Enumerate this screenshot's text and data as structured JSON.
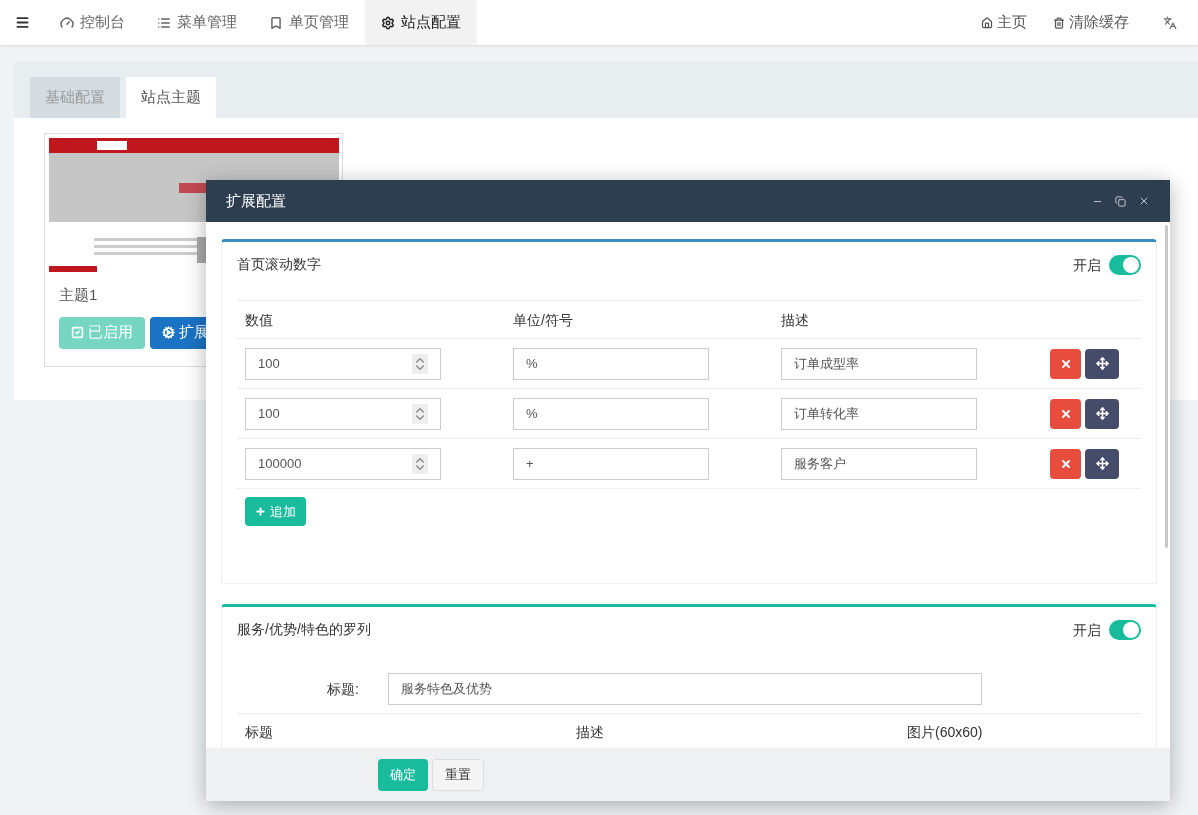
{
  "nav": {
    "items": [
      {
        "label": "控制台",
        "selected": false
      },
      {
        "label": "菜单管理",
        "selected": false
      },
      {
        "label": "单页管理",
        "selected": false
      },
      {
        "label": "站点配置",
        "selected": true
      }
    ],
    "right": [
      {
        "label": "主页"
      },
      {
        "label": "清除缓存"
      }
    ]
  },
  "tabs": [
    {
      "label": "基础配置",
      "selected": false
    },
    {
      "label": "站点主题",
      "selected": true
    }
  ],
  "theme": {
    "name": "主题1",
    "buttons": [
      {
        "label": "已启用",
        "kind": "enabled"
      },
      {
        "label": "扩展",
        "kind": "config"
      }
    ]
  },
  "modal": {
    "title": "扩展配置",
    "sections": [
      {
        "kind": "number_list",
        "title": "首页滚动数字",
        "color": "#3c8dbc",
        "toggle": {
          "label": "开启",
          "on": true
        },
        "columns": [
          "数值",
          "单位/符号",
          "描述"
        ],
        "rows": [
          {
            "value": "100",
            "unit": "%",
            "description": "订单成型率"
          },
          {
            "value": "100",
            "unit": "%",
            "description": "订单转化率"
          },
          {
            "value": "100000",
            "unit": "+",
            "description": "服务客户"
          }
        ],
        "add_button": "追加"
      },
      {
        "kind": "feature_list",
        "title": "服务/优势/特色的罗列",
        "color": "#18bc9c",
        "toggle": {
          "label": "开启",
          "on": true
        },
        "field": {
          "label": "标题:",
          "value": "服务特色及优势"
        },
        "columns": [
          "标题",
          "描述",
          "图片(60x60)"
        ]
      }
    ],
    "buttons": [
      {
        "label": "确定",
        "kind": "primary"
      },
      {
        "label": "重置",
        "kind": "default"
      }
    ]
  }
}
